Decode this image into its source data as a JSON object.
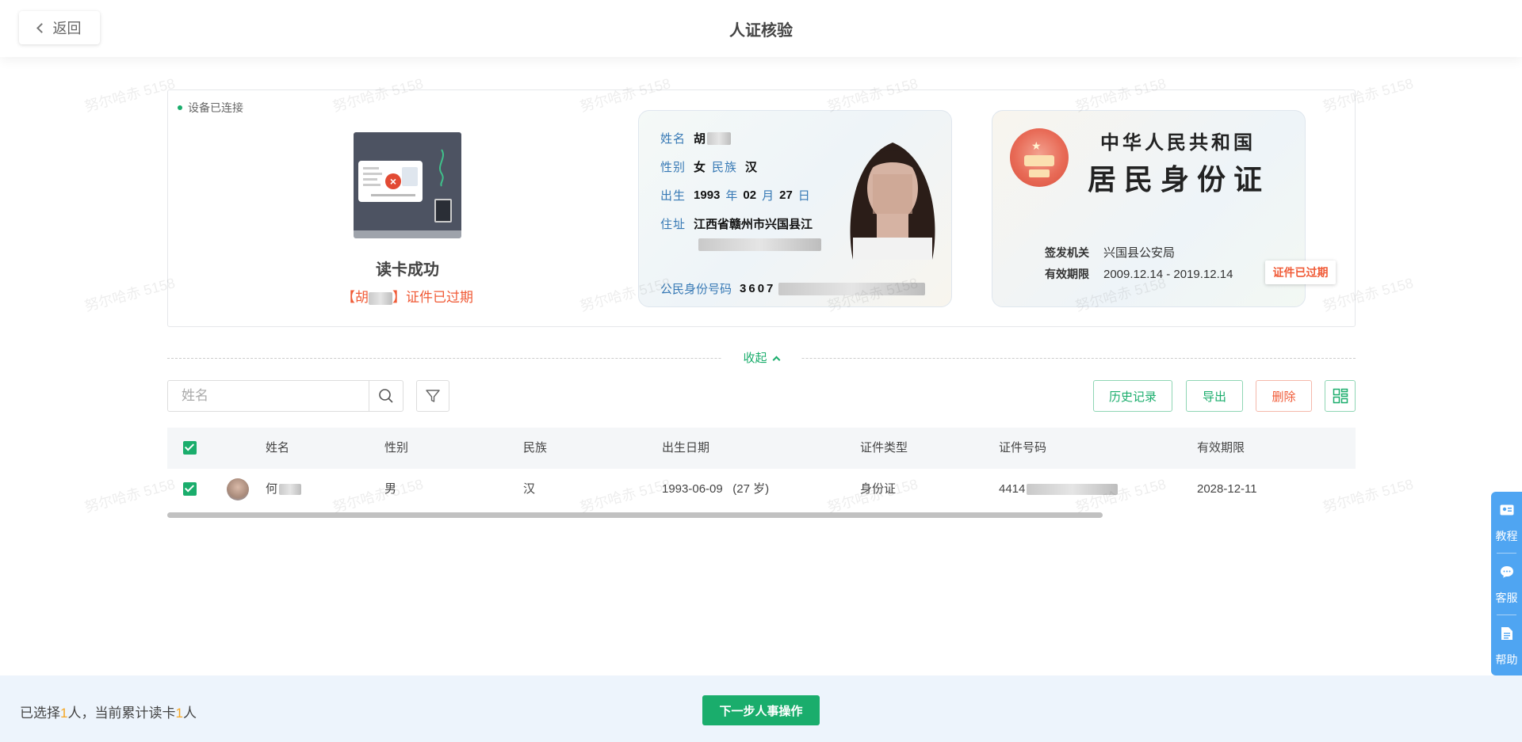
{
  "header": {
    "back_label": "返回",
    "title": "人证核验"
  },
  "watermark": {
    "text": "努尔哈赤 5158"
  },
  "reader": {
    "device_status": "设备已连接",
    "result_title": "读卡成功",
    "expired_prefix": "【胡",
    "expired_suffix": "】证件已过期"
  },
  "id_front": {
    "name_label": "姓名",
    "name_value": "胡",
    "gender_label": "性别",
    "gender_value": "女",
    "ethnic_label": "民族",
    "ethnic_value": "汉",
    "birth_label": "出生",
    "birth_year": "1993",
    "year_unit": "年",
    "birth_month": "02",
    "month_unit": "月",
    "birth_day": "27",
    "day_unit": "日",
    "address_label": "住址",
    "address_line1": "江西省赣州市兴国县江",
    "id_label": "公民身份号码",
    "id_prefix": "3607"
  },
  "id_back": {
    "nation": "中华人民共和国",
    "card_name": "居民身份证",
    "authority_label": "签发机关",
    "authority_value": "兴国县公安局",
    "validity_label": "有效期限",
    "validity_value": "2009.12.14 - 2019.12.14",
    "expired_badge": "证件已过期"
  },
  "collapse_label": "收起",
  "toolbar": {
    "search_placeholder": "姓名",
    "history_label": "历史记录",
    "export_label": "导出",
    "delete_label": "删除"
  },
  "table": {
    "columns": {
      "name": "姓名",
      "gender": "性别",
      "ethnic": "民族",
      "birth": "出生日期",
      "id_type": "证件类型",
      "id_number": "证件号码",
      "validity": "有效期限"
    },
    "rows": [
      {
        "name": "何",
        "gender": "男",
        "ethnic": "汉",
        "birth": "1993-06-09",
        "age": "(27 岁)",
        "id_type": "身份证",
        "id_number": "4414",
        "validity": "2028-12-11",
        "selected": true
      }
    ],
    "all_selected": true
  },
  "side_panel": {
    "tutorial": "教程",
    "service": "客服",
    "help": "帮助"
  },
  "footer": {
    "selected_prefix": "已选择",
    "selected_count": "1",
    "selected_mid": "人，当前累计读卡",
    "read_count": "1",
    "selected_suffix": "人",
    "next_label": "下一步人事操作"
  },
  "colors": {
    "accent": "#1aad6c",
    "danger": "#f05a36",
    "highlight": "#f5a623",
    "side_panel": "#4fa5f2"
  }
}
